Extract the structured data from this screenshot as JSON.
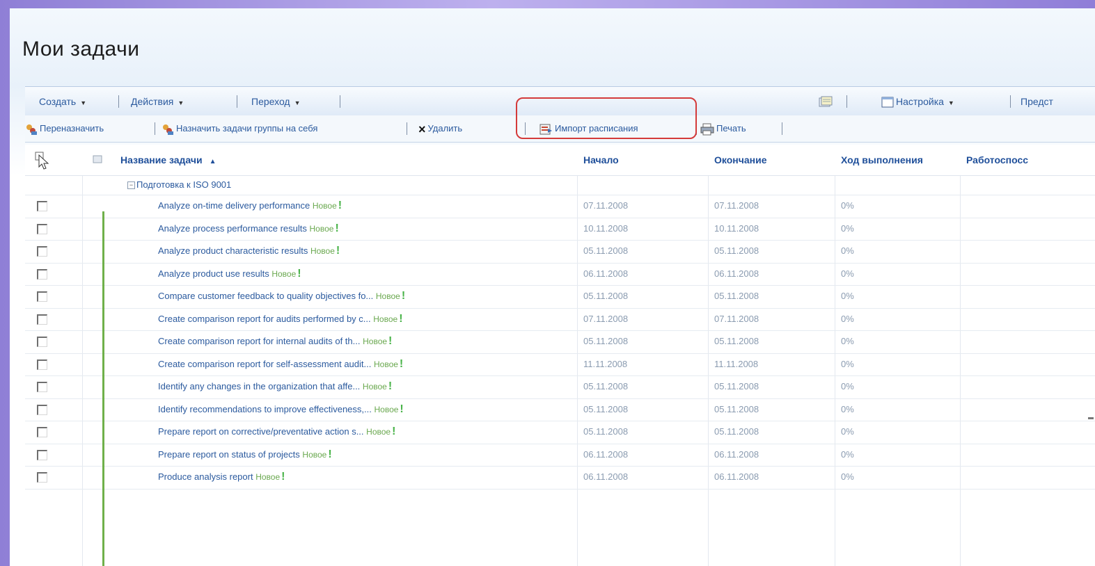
{
  "page": {
    "title": "Мои задачи"
  },
  "menu": {
    "create": "Создать",
    "actions": "Действия",
    "navigate": "Переход",
    "settings": "Настройка",
    "view": "Предст"
  },
  "actions": {
    "reassign": "Переназначить",
    "assign_group": "Назначить задачи группы на себя",
    "delete": "Удалить",
    "import_schedule": "Импорт расписания",
    "print": "Печать"
  },
  "columns": {
    "task_name": "Название задачи",
    "start": "Начало",
    "end": "Окончание",
    "progress": "Ход выполнения",
    "capacity": "Работоспосс"
  },
  "group": {
    "label": "Подготовка к ISO 9001"
  },
  "new_label": "Новое",
  "rows": [
    {
      "name": "Analyze on-time delivery performance",
      "start": "07.11.2008",
      "end": "07.11.2008",
      "progress": "0%"
    },
    {
      "name": "Analyze process performance results",
      "start": "10.11.2008",
      "end": "10.11.2008",
      "progress": "0%"
    },
    {
      "name": "Analyze product characteristic results",
      "start": "05.11.2008",
      "end": "05.11.2008",
      "progress": "0%"
    },
    {
      "name": "Analyze product use results",
      "start": "06.11.2008",
      "end": "06.11.2008",
      "progress": "0%"
    },
    {
      "name": "Compare customer feedback to quality objectives fo...",
      "start": "05.11.2008",
      "end": "05.11.2008",
      "progress": "0%"
    },
    {
      "name": "Create comparison report for audits performed by c...",
      "start": "07.11.2008",
      "end": "07.11.2008",
      "progress": "0%"
    },
    {
      "name": "Create comparison report for internal audits of th...",
      "start": "05.11.2008",
      "end": "05.11.2008",
      "progress": "0%"
    },
    {
      "name": "Create comparison report for self-assessment audit...",
      "start": "11.11.2008",
      "end": "11.11.2008",
      "progress": "0%"
    },
    {
      "name": "Identify any changes in the organization that affe...",
      "start": "05.11.2008",
      "end": "05.11.2008",
      "progress": "0%"
    },
    {
      "name": "Identify recommendations to improve effectiveness,...",
      "start": "05.11.2008",
      "end": "05.11.2008",
      "progress": "0%"
    },
    {
      "name": "Prepare report on corrective/preventative action s...",
      "start": "05.11.2008",
      "end": "05.11.2008",
      "progress": "0%"
    },
    {
      "name": "Prepare report on status of projects",
      "start": "06.11.2008",
      "end": "06.11.2008",
      "progress": "0%"
    },
    {
      "name": "Produce analysis report",
      "start": "06.11.2008",
      "end": "06.11.2008",
      "progress": "0%"
    }
  ],
  "icons": {
    "menu_arrow": "dropdown-arrow-icon",
    "delete": "x-icon",
    "sort": "sort-ascending-icon"
  },
  "colors": {
    "link": "#2b5a9e",
    "header": "#1f4f9a",
    "new": "#6aa84f",
    "highlight": "#d43a3a"
  }
}
